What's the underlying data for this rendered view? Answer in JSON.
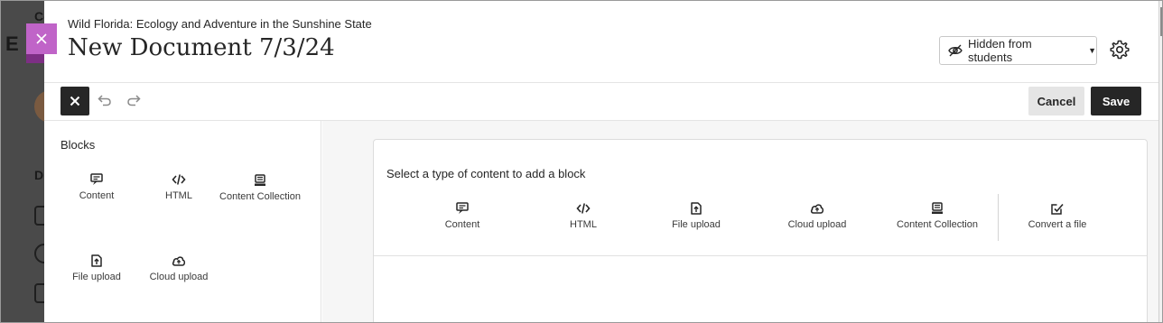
{
  "header": {
    "course_name": "Wild Florida: Ecology and Adventure in the Sunshine State",
    "document_title": "New Document 7/3/24",
    "visibility_label": "Hidden from students"
  },
  "toolbar": {
    "cancel_label": "Cancel",
    "save_label": "Save"
  },
  "sidebar": {
    "title": "Blocks",
    "items": [
      {
        "label": "Content",
        "icon": "content-icon"
      },
      {
        "label": "HTML",
        "icon": "html-code-icon"
      },
      {
        "label": "Content Collection",
        "icon": "content-collection-icon"
      },
      {
        "label": "File upload",
        "icon": "file-upload-icon"
      },
      {
        "label": "Cloud upload",
        "icon": "cloud-upload-icon"
      }
    ]
  },
  "main": {
    "prompt": "Select a type of content to add a block",
    "types": [
      {
        "label": "Content",
        "icon": "content-icon"
      },
      {
        "label": "HTML",
        "icon": "html-code-icon"
      },
      {
        "label": "File upload",
        "icon": "file-upload-icon"
      },
      {
        "label": "Cloud upload",
        "icon": "cloud-upload-icon"
      },
      {
        "label": "Content Collection",
        "icon": "content-collection-icon"
      },
      {
        "label": "Convert a file",
        "icon": "convert-file-icon"
      }
    ]
  },
  "colors": {
    "accent_close": "#c064c8",
    "primary_dark": "#262626",
    "cancel_bg": "#e5e5e5",
    "canvas_bg": "#f6f6f6"
  },
  "background_app": {
    "fragments": [
      "Co",
      "E",
      "D"
    ]
  }
}
